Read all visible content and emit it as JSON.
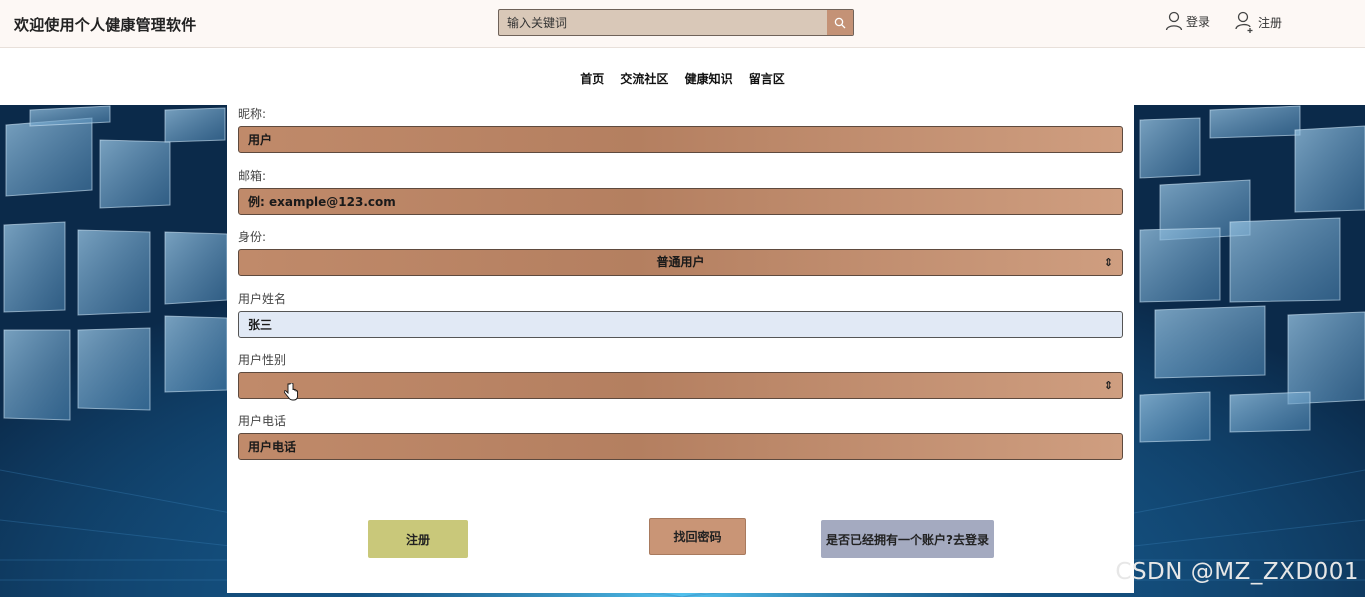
{
  "header": {
    "title": "欢迎使用个人健康管理软件",
    "search_placeholder": "输入关键词",
    "login_label": "登录",
    "register_label": "注册"
  },
  "nav": {
    "items": [
      "首页",
      "交流社区",
      "健康知识",
      "留言区"
    ]
  },
  "form": {
    "nickname": {
      "label": "昵称:",
      "value": "用户"
    },
    "email": {
      "label": "邮箱:",
      "placeholder": "例: example@123.com"
    },
    "identity": {
      "label": "身份:",
      "selected": "普通用户"
    },
    "username": {
      "label": "用户姓名",
      "value": "张三"
    },
    "gender": {
      "label": "用户性别",
      "selected": ""
    },
    "phone": {
      "label": "用户电话",
      "placeholder": "用户电话"
    }
  },
  "buttons": {
    "register": "注册",
    "forgot": "找回密码",
    "to_login": "是否已经拥有一个账户?去登录"
  },
  "watermark": "CSDN @MZ_ZXD001",
  "colors": {
    "field_brown": "#b98465",
    "register_btn": "#c9c87a",
    "forgot_btn": "#c99576",
    "login_btn": "#a4aac0",
    "field_light": "#e1e9f5"
  }
}
